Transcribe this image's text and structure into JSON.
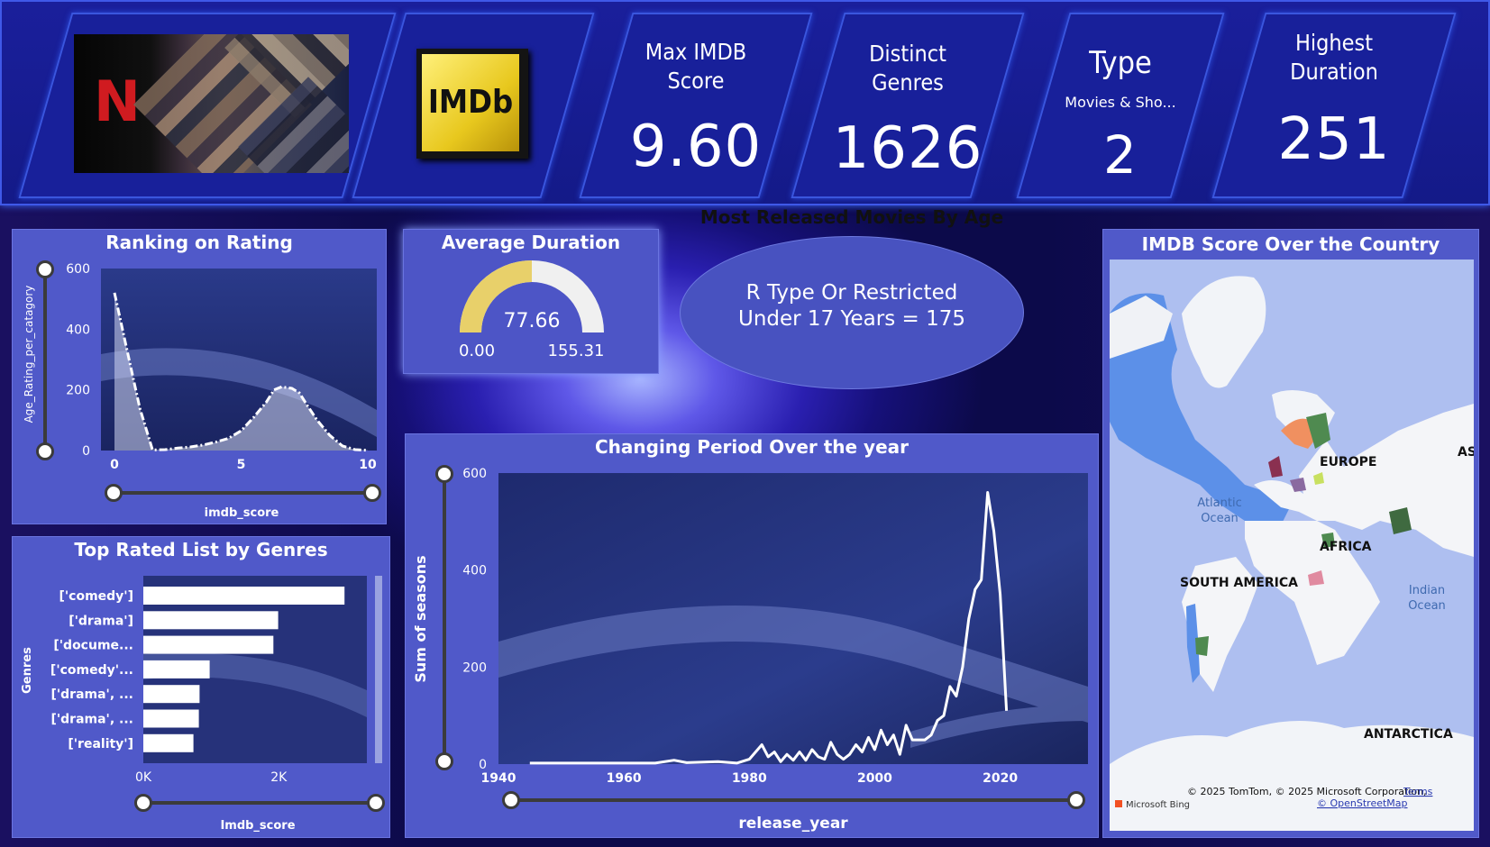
{
  "kpis": {
    "max_imdb": {
      "label_line1": "Max IMDB",
      "label_line2": "Score",
      "value": "9.60"
    },
    "distinct_genres": {
      "label_line1": "Distinct",
      "label_line2": "Genres",
      "value": "1626"
    },
    "type": {
      "label": "Type",
      "sub": "Movies & Sho...",
      "value": "2"
    },
    "highest_duration": {
      "label_line1": "Highest",
      "label_line2": "Duration",
      "value": "251"
    }
  },
  "logos": {
    "netflix": "N",
    "imdb": "IMDb"
  },
  "ranking": {
    "title": "Ranking on Rating",
    "ylabel": "Age_Rating_per_catagory",
    "xlabel": "imdb_score",
    "yticks": [
      "600",
      "400",
      "200",
      "0"
    ],
    "xticks": [
      "0",
      "5",
      "10"
    ]
  },
  "avg_duration": {
    "title": "Average Duration",
    "value": "77.66",
    "min": "0.00",
    "max": "155.31",
    "fraction": 0.5
  },
  "age_card": {
    "title": "Most Released Movies By Age",
    "line1": "R Type Or Restricted",
    "line2": "Under 17 Years = 175"
  },
  "map": {
    "title": "IMDB Score Over the Country",
    "labels": {
      "europe": "EUROPE",
      "asia": "AS",
      "africa": "AFRICA",
      "south_america": "SOUTH AMERICA",
      "antarctica": "ANTARCTICA",
      "atlantic1": "Atlantic",
      "atlantic2": "Ocean",
      "indian1": "Indian",
      "indian2": "Ocean"
    },
    "attribution": "© 2025 TomTom, © 2025 Microsoft Corporation,",
    "terms": "Terms",
    "osm": "© OpenStreetMap",
    "bing": "Microsoft Bing"
  },
  "genres": {
    "title": "Top Rated List by Genres",
    "ylabel": "Genres",
    "xlabel": "Imdb_score",
    "xticks": [
      "0K",
      "2K"
    ],
    "categories": [
      "['comedy']",
      "['drama']",
      "['docume...",
      "['comedy'...",
      "['drama', ...",
      "['drama', ...",
      "['reality']"
    ]
  },
  "period": {
    "title": "Changing Period Over the year",
    "ylabel": "Sum of seasons",
    "xlabel": "release_year",
    "yticks": [
      "600",
      "400",
      "200",
      "0"
    ],
    "xticks": [
      "1940",
      "1960",
      "1980",
      "2000",
      "2020"
    ]
  },
  "chart_data": [
    {
      "type": "area",
      "title": "Ranking on Rating",
      "xlabel": "imdb_score",
      "ylabel": "Age_Rating_per_catagory",
      "xlim": [
        0,
        10
      ],
      "ylim": [
        0,
        600
      ],
      "x": [
        0,
        0.5,
        1,
        1.5,
        2,
        2.5,
        3,
        3.5,
        4,
        4.5,
        5,
        5.5,
        6,
        6.3,
        6.6,
        7,
        7.3,
        7.6,
        8,
        8.5,
        9,
        9.5,
        10
      ],
      "y": [
        520,
        330,
        140,
        2,
        3,
        8,
        12,
        18,
        28,
        40,
        65,
        110,
        160,
        200,
        210,
        205,
        190,
        150,
        100,
        50,
        15,
        3,
        1
      ]
    },
    {
      "type": "bar",
      "title": "Top Rated List by Genres",
      "xlabel": "Imdb_score",
      "ylabel": "Genres",
      "categories": [
        "['comedy']",
        "['drama']",
        "['docume...",
        "['comedy'...",
        "['drama', ...",
        "['drama', ...",
        "['reality']"
      ],
      "values": [
        2970,
        1990,
        1920,
        980,
        830,
        820,
        740
      ],
      "xlim": [
        0,
        3300
      ]
    },
    {
      "type": "line",
      "title": "Changing Period Over the year",
      "xlabel": "release_year",
      "ylabel": "Sum of seasons",
      "xlim": [
        1940,
        2034
      ],
      "ylim": [
        0,
        600
      ],
      "x": [
        1945,
        1950,
        1955,
        1960,
        1965,
        1968,
        1970,
        1975,
        1978,
        1980,
        1982,
        1983,
        1984,
        1985,
        1986,
        1987,
        1988,
        1989,
        1990,
        1991,
        1992,
        1993,
        1994,
        1995,
        1996,
        1997,
        1998,
        1999,
        2000,
        2001,
        2002,
        2003,
        2004,
        2005,
        2006,
        2007,
        2008,
        2009,
        2010,
        2011,
        2012,
        2013,
        2014,
        2015,
        2016,
        2017,
        2018,
        2019,
        2020,
        2021
      ],
      "y": [
        2,
        2,
        2,
        2,
        2,
        8,
        3,
        5,
        2,
        10,
        40,
        15,
        25,
        5,
        20,
        8,
        25,
        8,
        30,
        15,
        10,
        45,
        20,
        10,
        20,
        40,
        25,
        55,
        30,
        70,
        40,
        60,
        20,
        80,
        50,
        50,
        50,
        60,
        90,
        100,
        160,
        140,
        200,
        300,
        360,
        380,
        560,
        480,
        350,
        110
      ]
    }
  ]
}
